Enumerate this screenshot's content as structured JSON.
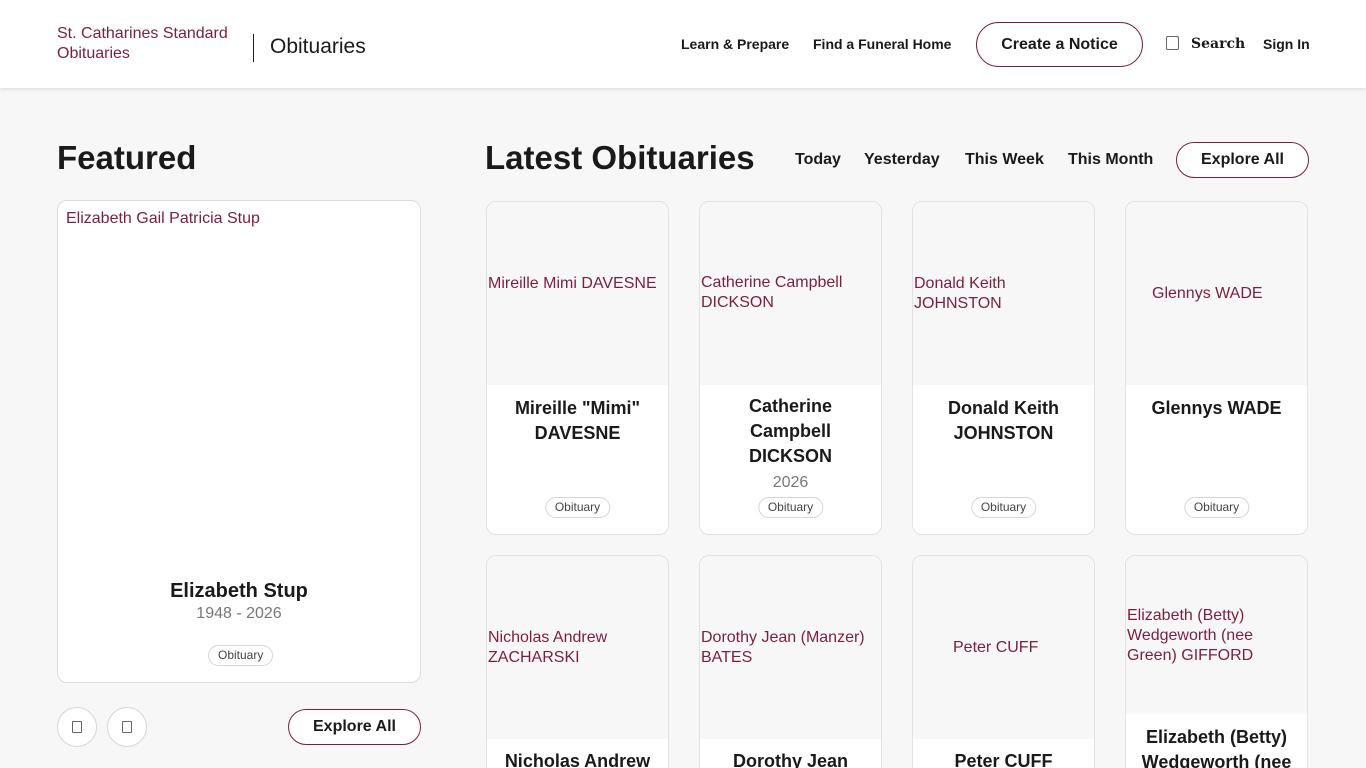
{
  "header": {
    "logo_alt": "St. Catharines Standard Obituaries",
    "brand_title": "Obituaries",
    "nav": [
      "Learn & Prepare",
      "Find a Funeral Home"
    ],
    "create_button": "Create a Notice",
    "search_label": "Search",
    "signin_label": "Sign In"
  },
  "featured": {
    "title": "Featured",
    "image_alt": "Elizabeth Gail Patricia Stup",
    "name": "Elizabeth Stup",
    "dates": "1948 - 2026",
    "badge": "Obituary",
    "explore_label": "Explore All"
  },
  "latest": {
    "title": "Latest Obituaries",
    "filters": [
      "Today",
      "Yesterday",
      "This Week",
      "This Month"
    ],
    "explore_label": "Explore All",
    "cards": [
      {
        "image_alt": "Mireille Mimi DAVESNE",
        "name": "Mireille \"Mimi\" DAVESNE",
        "year": "",
        "badge": "Obituary"
      },
      {
        "image_alt": "Catherine Campbell DICKSON",
        "name": "Catherine Campbell DICKSON",
        "year": "2026",
        "badge": "Obituary"
      },
      {
        "image_alt": "Donald Keith JOHNSTON",
        "name": "Donald Keith JOHNSTON",
        "year": "",
        "badge": "Obituary"
      },
      {
        "image_alt": "Glennys WADE",
        "name": "Glennys WADE",
        "year": "",
        "badge": "Obituary"
      },
      {
        "image_alt": "Nicholas Andrew ZACHARSKI",
        "name": "Nicholas Andrew",
        "year": "",
        "badge": ""
      },
      {
        "image_alt": "Dorothy Jean (Manzer) BATES",
        "name": "Dorothy Jean",
        "year": "",
        "badge": ""
      },
      {
        "image_alt": "Peter CUFF",
        "name": "Peter CUFF",
        "year": "",
        "badge": ""
      },
      {
        "image_alt": "Elizabeth (Betty) Wedgeworth (nee Green) GIFFORD",
        "name": "Elizabeth (Betty) Wedgeworth (nee",
        "year": "",
        "badge": ""
      }
    ]
  },
  "icons": {
    "search": "search-icon",
    "carousel_prev": "chevron-left-icon",
    "carousel_next": "chevron-right-icon"
  },
  "colors": {
    "accent": "#7a1f3d",
    "background": "#f7f7f7",
    "card": "#ffffff"
  }
}
